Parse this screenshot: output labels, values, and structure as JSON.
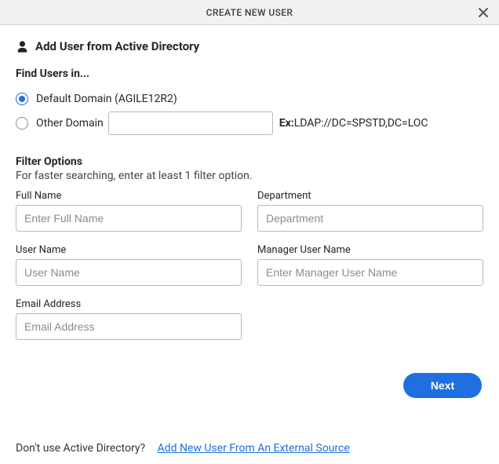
{
  "header": {
    "title": "CREATE NEW USER"
  },
  "section": {
    "title": "Add User from Active Directory"
  },
  "find": {
    "label": "Find Users in...",
    "default_label": "Default Domain (AGILE12R2)",
    "other_label": "Other Domain",
    "other_value": "",
    "example_prefix": "Ex:",
    "example_value": " LDAP://DC=SPSTD,DC=LOC"
  },
  "filter": {
    "title": "Filter Options",
    "subtitle": "For faster searching, enter at least 1 filter option.",
    "full_name_label": "Full Name",
    "full_name_placeholder": "Enter Full Name",
    "department_label": "Department",
    "department_placeholder": "Department",
    "user_name_label": "User Name",
    "user_name_placeholder": "User Name",
    "manager_label": "Manager User Name",
    "manager_placeholder": "Enter Manager User Name",
    "email_label": "Email Address",
    "email_placeholder": "Email Address"
  },
  "buttons": {
    "next": "Next"
  },
  "bottom": {
    "question": "Don't use Active Directory?",
    "link": "Add New User From An External Source"
  }
}
